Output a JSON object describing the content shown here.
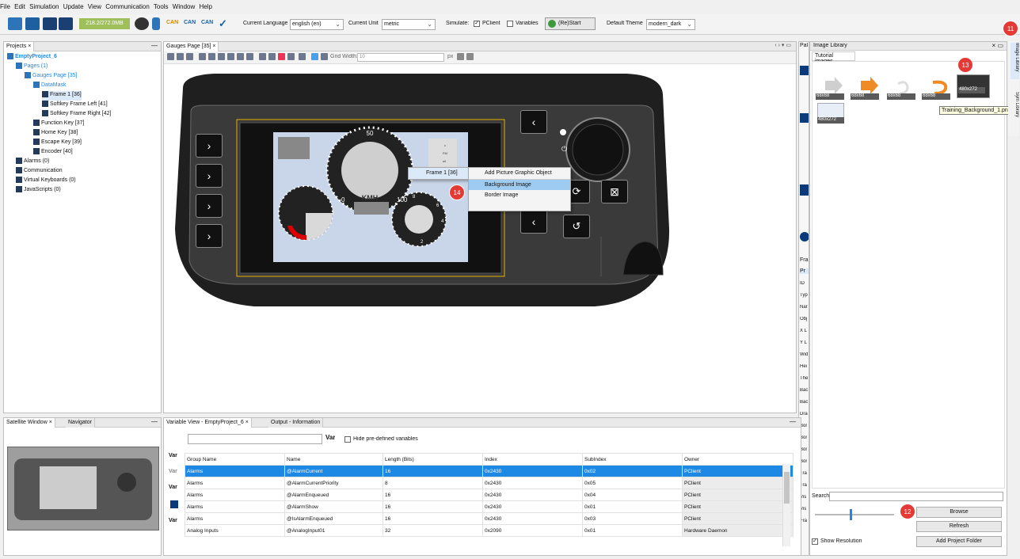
{
  "menu": [
    "File",
    "Edit",
    "Simulation",
    "Update",
    "View",
    "Communication",
    "Tools",
    "Window",
    "Help"
  ],
  "toolbar": {
    "memory": "218.2/272.0MB",
    "can_labels": [
      "CAN",
      "CAN",
      "CAN"
    ],
    "current_language_label": "Current Language",
    "current_language_value": "english (en)",
    "current_unit_label": "Current Unit",
    "current_unit_value": "metric",
    "simulate_label": "Simulate:",
    "pclient_label": "PClient",
    "variables_label": "Variables",
    "restart_label": "(Re)Start",
    "default_theme_label": "Default Theme",
    "default_theme_value": "modern_dark"
  },
  "projects": {
    "tab": "Projects",
    "tree": [
      {
        "label": "EmptyProject_6",
        "indent": 0,
        "color": "#1e88e5",
        "bold": true
      },
      {
        "label": "Pages (1)",
        "indent": 1,
        "color": "#1e88e5"
      },
      {
        "label": "Gauges Page [35]",
        "indent": 2,
        "color": "#1e88e5"
      },
      {
        "label": "DataMask",
        "indent": 3,
        "color": "#1e88e5"
      },
      {
        "label": "Frame 1 [36]",
        "indent": 4,
        "color": "#111",
        "selected": true
      },
      {
        "label": "Softkey Frame Left [41]",
        "indent": 4,
        "color": "#111"
      },
      {
        "label": "Softkey Frame Right [42]",
        "indent": 4,
        "color": "#111"
      },
      {
        "label": "Function Key [37]",
        "indent": 3,
        "color": "#111"
      },
      {
        "label": "Home Key [38]",
        "indent": 3,
        "color": "#111"
      },
      {
        "label": "Escape Key [39]",
        "indent": 3,
        "color": "#111"
      },
      {
        "label": "Encoder [40]",
        "indent": 3,
        "color": "#111"
      },
      {
        "label": "Alarms (0)",
        "indent": 1,
        "color": "#111"
      },
      {
        "label": "Communication",
        "indent": 1,
        "color": "#111"
      },
      {
        "label": "Virtual Keyboards (0)",
        "indent": 1,
        "color": "#111"
      },
      {
        "label": "JavaScripts (0)",
        "indent": 1,
        "color": "#111"
      }
    ]
  },
  "editor": {
    "tab": "Gauges Page [35]",
    "grid_width_label": "Grid Width:",
    "grid_width_value": "10",
    "grid_unit": "px",
    "gauge": {
      "top_mark": "50",
      "unit": "KMH",
      "left_mark": "0",
      "right_mark": "100",
      "right_top": "8",
      "right_mid": "6",
      "right_low": "4",
      "right_bottom": "2",
      "small_labels": [
        "c",
        "FM",
        "oil"
      ]
    }
  },
  "context_menu": {
    "frame_label": "Frame 1 [36]",
    "items": [
      "Add Picture Graphic Object",
      "Background Image",
      "Border Image"
    ],
    "highlighted": "Background Image"
  },
  "satellite": {
    "tab1": "Satellite Window",
    "tab2": "Navigator"
  },
  "varview": {
    "tab1": "Variable View - EmptyProject_6",
    "tab2": "Output - Information",
    "hide_label": "Hide pre-defined variables",
    "var_word": "Var",
    "columns": [
      "Group Name",
      "Name",
      "Length (Bits)",
      "Index",
      "SubIndex",
      "Owner"
    ],
    "rows": [
      [
        "Alarms",
        "@AlarmCurrent",
        "16",
        "0x2430",
        "0x02",
        "PClient"
      ],
      [
        "Alarms",
        "@AlarmCurrentPriority",
        "8",
        "0x2430",
        "0x05",
        "PClient"
      ],
      [
        "Alarms",
        "@AlarmEnqueued",
        "16",
        "0x2430",
        "0x04",
        "PClient"
      ],
      [
        "Alarms",
        "@AlarmShow",
        "16",
        "0x2430",
        "0x01",
        "PClient"
      ],
      [
        "Alarms",
        "@IsAlarmEnqueued",
        "16",
        "0x2430",
        "0x03",
        "PClient"
      ],
      [
        "Analog Inputs",
        "@AnalogInput01",
        "32",
        "0x2090",
        "0x01",
        "Hardware Daemon"
      ]
    ]
  },
  "properties": {
    "tab": "Pal",
    "frame_tab": "Fra",
    "pr_tab": "Pr",
    "labels": [
      "ID",
      "Typ",
      "Nar",
      "Obj",
      "X L",
      "Y L",
      "Wid",
      "Hei",
      "The",
      "Bac",
      "Bac",
      "Dra",
      "Bor",
      "Bor",
      "Bor",
      "Bor",
      "Tra",
      "Tra",
      "Vis",
      "Vis",
      "Fra"
    ]
  },
  "image_library": {
    "title": "Image Library",
    "tab": "Tutorial images",
    "thumbs": [
      "68x68",
      "68x68",
      "68x68",
      "68x68",
      "480x272",
      "480x272"
    ],
    "tooltip": "Training_Background_1.png",
    "search_label": "Search",
    "browse": "Browse",
    "refresh": "Refresh",
    "add_folder": "Add Project Folder",
    "show_resolution": "Show Resolution",
    "side_tabs": [
      "Image Library",
      "Sym Library"
    ]
  },
  "badges": {
    "b11": "11",
    "b12": "12",
    "b13": "13",
    "b14": "14"
  },
  "colors": {
    "accent": "#1e88e5",
    "badge": "#e53935",
    "selected_row": "#1e88e5"
  }
}
